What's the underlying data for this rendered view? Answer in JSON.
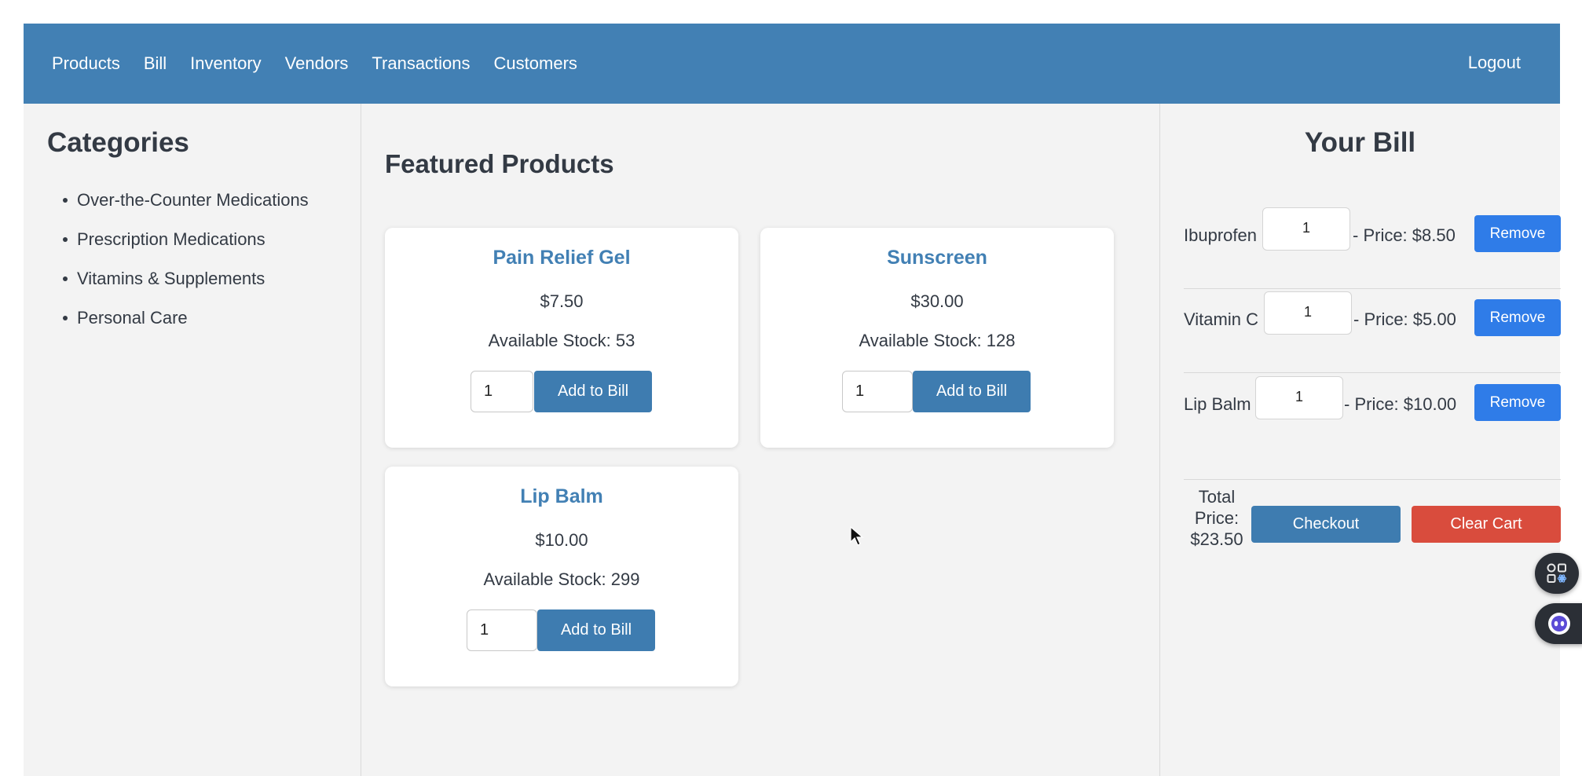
{
  "nav": {
    "links": [
      "Products",
      "Bill",
      "Inventory",
      "Vendors",
      "Transactions",
      "Customers"
    ],
    "logout": "Logout"
  },
  "sidebar": {
    "title": "Categories",
    "items": [
      "Over-the-Counter Medications",
      "Prescription Medications",
      "Vitamins & Supplements",
      "Personal Care"
    ]
  },
  "main": {
    "title": "Featured Products",
    "products": [
      {
        "name": "Pain Relief Gel",
        "price": "$7.50",
        "stock": "Available Stock: 53",
        "qty": "1",
        "button": "Add to Bill"
      },
      {
        "name": "Sunscreen",
        "price": "$30.00",
        "stock": "Available Stock: 128",
        "qty": "1",
        "button": "Add to Bill"
      },
      {
        "name": "Lip Balm",
        "price": "$10.00",
        "stock": "Available Stock: 299",
        "qty": "1",
        "button": "Add to Bill"
      }
    ]
  },
  "bill": {
    "title": "Your Bill",
    "items": [
      {
        "name": "Ibuprofen",
        "qty": "1",
        "price": "- Price: $8.50",
        "remove": "Remove"
      },
      {
        "name": "Vitamin C",
        "qty": "1",
        "price": "- Price: $5.00",
        "remove": "Remove"
      },
      {
        "name": "Lip Balm",
        "qty": "1",
        "price": "- Price: $10.00",
        "remove": "Remove"
      }
    ],
    "total_lines": [
      "Total",
      "Price:",
      "$23.50"
    ],
    "checkout": "Checkout",
    "clear": "Clear Cart"
  },
  "colors": {
    "navbar": "#4280b4",
    "primary_button": "#3e7cb0",
    "remove_button": "#2f7ce8",
    "clear_button": "#d94c3d",
    "background": "#f3f3f3"
  },
  "floating_icons": [
    "apps-icon",
    "assistant-bot-icon"
  ]
}
